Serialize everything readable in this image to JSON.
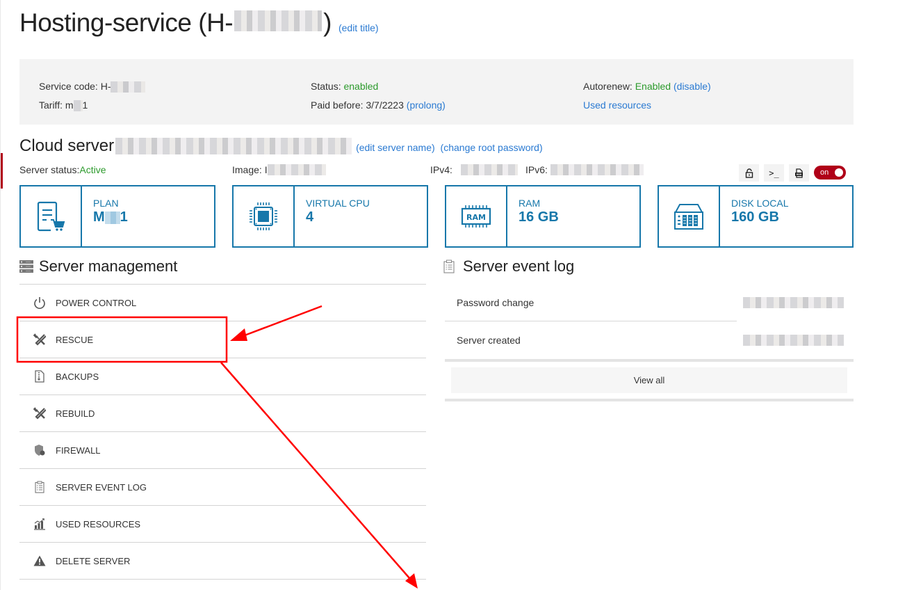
{
  "page": {
    "title_prefix": "Hosting-service (H-",
    "title_suffix": ")",
    "edit_title_link": "(edit title)"
  },
  "service_info": {
    "service_code_label": "Service code: H-",
    "tariff_label": "Tariff: m",
    "tariff_suffix": "1",
    "status_label": "Status: ",
    "status_value": "enabled",
    "paid_before_label": "Paid before: 3/7/2223 ",
    "prolong_link": "(prolong)",
    "autorenew_label": "Autorenew: ",
    "autorenew_value": "Enabled",
    "disable_link": "(disable)",
    "used_resources_link": "Used resources"
  },
  "server": {
    "title": "Cloud server",
    "edit_name_link": "(edit server name)",
    "change_password_link": "(change root password)",
    "status_label": "Server status: ",
    "status_value": "Active",
    "image_label": "Image: I",
    "ipv4_label": "IPv4:",
    "ipv6_label": "IPv6:",
    "toggle_label": "on",
    "console_label": ">_"
  },
  "cards": [
    {
      "label": "PLAN",
      "value_prefix": "M",
      "value_suffix": "1",
      "icon": "plan-cart-icon"
    },
    {
      "label": "VIRTUAL CPU",
      "value": "4",
      "icon": "cpu-icon"
    },
    {
      "label": "RAM",
      "value": "16 GB",
      "icon": "ram-icon"
    },
    {
      "label": "DISK LOCAL",
      "value": "160 GB",
      "icon": "disk-icon"
    }
  ],
  "management": {
    "title": "Server management",
    "items": [
      {
        "label": "POWER CONTROL",
        "icon": "power-icon"
      },
      {
        "label": "RESCUE",
        "icon": "tools-icon"
      },
      {
        "label": "BACKUPS",
        "icon": "archive-file-icon"
      },
      {
        "label": "REBUILD",
        "icon": "tools-icon"
      },
      {
        "label": "FIREWALL",
        "icon": "shield-icon"
      },
      {
        "label": "SERVER EVENT LOG",
        "icon": "clipboard-list-icon"
      },
      {
        "label": "USED RESOURCES",
        "icon": "bar-chart-icon"
      },
      {
        "label": "DELETE SERVER",
        "icon": "warning-icon"
      }
    ]
  },
  "event_log": {
    "title": "Server event log",
    "rows": [
      {
        "event": "Password change"
      },
      {
        "event": "Server created"
      }
    ],
    "view_all_label": "View all"
  },
  "colors": {
    "accent_blue": "#1677aa",
    "link_blue": "#2a7ad2",
    "status_green": "#2c9a2c",
    "toggle_red": "#b00018",
    "annotation_red": "#ff0000"
  }
}
